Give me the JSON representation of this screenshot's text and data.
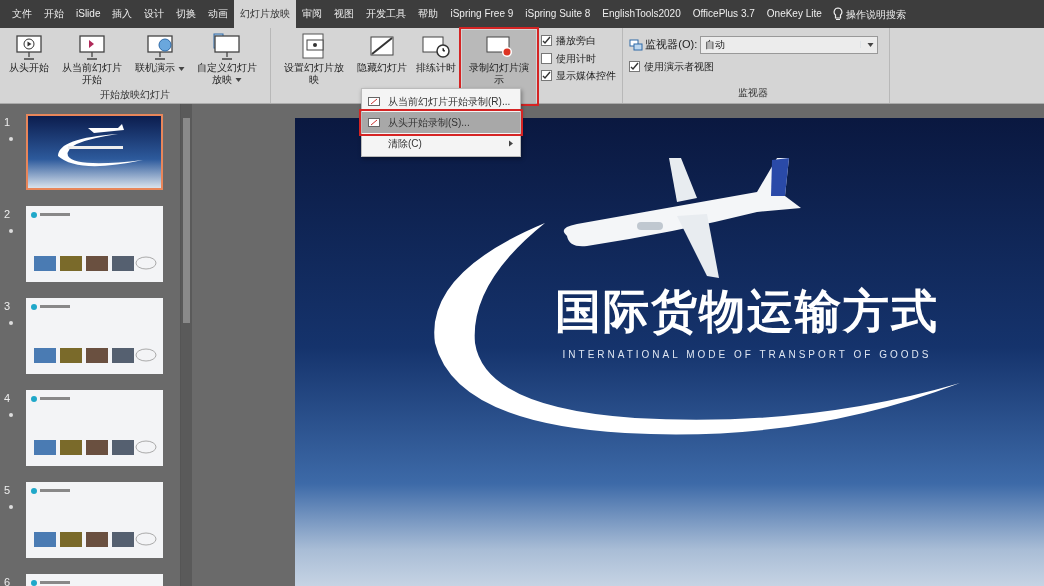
{
  "ribbon_tabs": [
    {
      "label": "文件",
      "selected": false
    },
    {
      "label": "开始",
      "selected": false
    },
    {
      "label": "iSlide",
      "selected": false
    },
    {
      "label": "插入",
      "selected": false
    },
    {
      "label": "设计",
      "selected": false
    },
    {
      "label": "切换",
      "selected": false
    },
    {
      "label": "动画",
      "selected": false
    },
    {
      "label": "幻灯片放映",
      "selected": true
    },
    {
      "label": "审阅",
      "selected": false
    },
    {
      "label": "视图",
      "selected": false
    },
    {
      "label": "开发工具",
      "selected": false
    },
    {
      "label": "帮助",
      "selected": false
    },
    {
      "label": "iSpring Free 9",
      "selected": false
    },
    {
      "label": "iSpring Suite 8",
      "selected": false
    },
    {
      "label": "EnglishTools2020",
      "selected": false
    },
    {
      "label": "OfficePlus 3.7",
      "selected": false
    },
    {
      "label": "OneKey Lite",
      "selected": false
    }
  ],
  "tell_me": "操作说明搜索",
  "start_group": {
    "label": "开始放映幻灯片",
    "buttons": [
      {
        "label": "从头开始",
        "kind": "play",
        "dropdown": false
      },
      {
        "label": "从当前幻灯片开始",
        "kind": "current",
        "dropdown": false
      },
      {
        "label": "联机演示",
        "kind": "online",
        "dropdown": true
      },
      {
        "label": "自定义幻灯片放映",
        "kind": "custom",
        "dropdown": true
      }
    ]
  },
  "setup_group": {
    "buttons": [
      {
        "label": "设置幻灯片放映",
        "kind": "setup",
        "highlighted": false
      },
      {
        "label": "隐藏幻灯片",
        "kind": "hide",
        "highlighted": false
      },
      {
        "label": "排练计时",
        "kind": "timing",
        "highlighted": false
      },
      {
        "label": "录制幻灯片演示",
        "kind": "record",
        "highlighted": true
      }
    ],
    "checkboxes": [
      {
        "label": "播放旁白",
        "checked": true
      },
      {
        "label": "使用计时",
        "checked": false
      },
      {
        "label": "显示媒体控件",
        "checked": true
      }
    ]
  },
  "monitor_group": {
    "label": "监视器",
    "monitor_label": "监视器(O):",
    "monitor_value": "自动",
    "presenter_view": {
      "label": "使用演示者视图",
      "checked": true
    }
  },
  "record_menu": [
    {
      "label": "从当前幻灯片开始录制(R)...",
      "selected": false,
      "submenu": false
    },
    {
      "label": "从头开始录制(S)...",
      "selected": true,
      "submenu": false
    },
    {
      "label": "清除(C)",
      "selected": false,
      "submenu": true
    }
  ],
  "slides": [
    {
      "number": "1",
      "kind": "title",
      "selected": true
    },
    {
      "number": "2",
      "kind": "content",
      "selected": false
    },
    {
      "number": "3",
      "kind": "content",
      "selected": false
    },
    {
      "number": "4",
      "kind": "content",
      "selected": false
    },
    {
      "number": "5",
      "kind": "content",
      "selected": false
    },
    {
      "number": "6",
      "kind": "content",
      "selected": false
    }
  ],
  "slide": {
    "title": "国际货物运输方式",
    "subtitle": "INTERNATIONAL MODE OF TRANSPORT OF GOODS"
  }
}
